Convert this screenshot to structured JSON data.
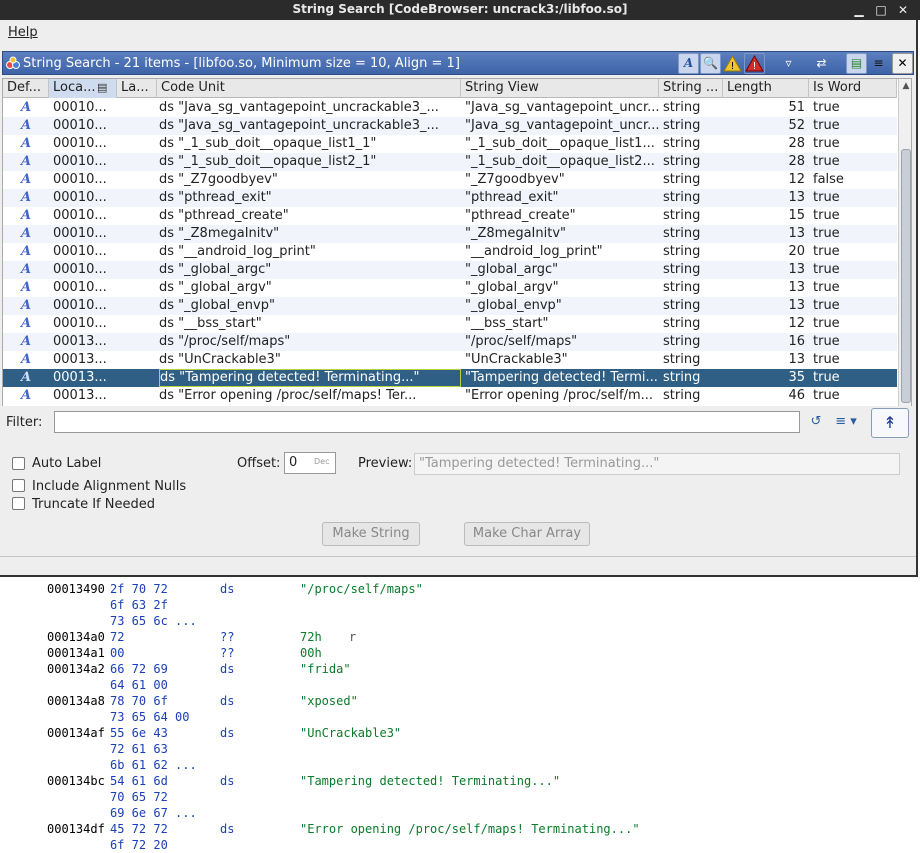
{
  "window": {
    "title": "String Search [CodeBrowser: uncrack3:/libfoo.so]",
    "minimize_glyph": "▁",
    "maximize_glyph": "□",
    "close_glyph": "✕"
  },
  "menu": {
    "help": "Help"
  },
  "panel": {
    "title": "String Search - 21 items - [libfoo.so, Minimum size = 10, Align = 1]",
    "toolbar_icons": [
      "string-type-icon",
      "search-icon",
      "warning-icon",
      "error-icon",
      "filter-icon",
      "refresh-icon",
      "make-selection-icon",
      "column-menu-icon",
      "close-panel-icon"
    ]
  },
  "table": {
    "columns": [
      "Def...",
      "Loca...",
      "La...",
      "Code Unit",
      "String View",
      "String ...",
      "Length",
      "Is Word"
    ],
    "selected_row_index": 15,
    "rows": [
      {
        "def": "A",
        "location": "00010...",
        "label": "",
        "code_unit": "ds \"Java_sg_vantagepoint_uncrackable3_...",
        "string_view": "\"Java_sg_vantagepoint_uncr...",
        "string_type": "string",
        "length": "51",
        "is_word": "true"
      },
      {
        "def": "A",
        "location": "00010...",
        "label": "",
        "code_unit": "ds \"Java_sg_vantagepoint_uncrackable3_...",
        "string_view": "\"Java_sg_vantagepoint_uncr...",
        "string_type": "string",
        "length": "52",
        "is_word": "true"
      },
      {
        "def": "A",
        "location": "00010...",
        "label": "",
        "code_unit": "ds \"_1_sub_doit__opaque_list1_1\"",
        "string_view": "\"_1_sub_doit__opaque_list1...",
        "string_type": "string",
        "length": "28",
        "is_word": "true"
      },
      {
        "def": "A",
        "location": "00010...",
        "label": "",
        "code_unit": "ds \"_1_sub_doit__opaque_list2_1\"",
        "string_view": "\"_1_sub_doit__opaque_list2...",
        "string_type": "string",
        "length": "28",
        "is_word": "true"
      },
      {
        "def": "A",
        "location": "00010...",
        "label": "",
        "code_unit": "ds \"_Z7goodbyev\"",
        "string_view": "\"_Z7goodbyev\"",
        "string_type": "string",
        "length": "12",
        "is_word": "false"
      },
      {
        "def": "A",
        "location": "00010...",
        "label": "",
        "code_unit": "ds \"pthread_exit\"",
        "string_view": "\"pthread_exit\"",
        "string_type": "string",
        "length": "13",
        "is_word": "true"
      },
      {
        "def": "A",
        "location": "00010...",
        "label": "",
        "code_unit": "ds \"pthread_create\"",
        "string_view": "\"pthread_create\"",
        "string_type": "string",
        "length": "15",
        "is_word": "true"
      },
      {
        "def": "A",
        "location": "00010...",
        "label": "",
        "code_unit": "ds \"_Z8megaInitv\"",
        "string_view": "\"_Z8megaInitv\"",
        "string_type": "string",
        "length": "13",
        "is_word": "true"
      },
      {
        "def": "A",
        "location": "00010...",
        "label": "",
        "code_unit": "ds \"__android_log_print\"",
        "string_view": "\"__android_log_print\"",
        "string_type": "string",
        "length": "20",
        "is_word": "true"
      },
      {
        "def": "A",
        "location": "00010...",
        "label": "",
        "code_unit": "ds \"_global_argc\"",
        "string_view": "\"_global_argc\"",
        "string_type": "string",
        "length": "13",
        "is_word": "true"
      },
      {
        "def": "A",
        "location": "00010...",
        "label": "",
        "code_unit": "ds \"_global_argv\"",
        "string_view": "\"_global_argv\"",
        "string_type": "string",
        "length": "13",
        "is_word": "true"
      },
      {
        "def": "A",
        "location": "00010...",
        "label": "",
        "code_unit": "ds \"_global_envp\"",
        "string_view": "\"_global_envp\"",
        "string_type": "string",
        "length": "13",
        "is_word": "true"
      },
      {
        "def": "A",
        "location": "00010...",
        "label": "",
        "code_unit": "ds \"__bss_start\"",
        "string_view": "\"__bss_start\"",
        "string_type": "string",
        "length": "12",
        "is_word": "true"
      },
      {
        "def": "A",
        "location": "00013...",
        "label": "",
        "code_unit": "ds \"/proc/self/maps\"",
        "string_view": "\"/proc/self/maps\"",
        "string_type": "string",
        "length": "16",
        "is_word": "true"
      },
      {
        "def": "A",
        "location": "00013...",
        "label": "",
        "code_unit": "ds \"UnCrackable3\"",
        "string_view": "\"UnCrackable3\"",
        "string_type": "string",
        "length": "13",
        "is_word": "true"
      },
      {
        "def": "A",
        "location": "00013...",
        "label": "",
        "code_unit": "ds \"Tampering detected! Terminating...\"",
        "string_view": "\"Tampering detected! Termi...",
        "string_type": "string",
        "length": "35",
        "is_word": "true"
      },
      {
        "def": "A",
        "location": "00013...",
        "label": "",
        "code_unit": "ds \"Error opening /proc/self/maps! Ter...",
        "string_view": "\"Error opening /proc/self/m...",
        "string_type": "string",
        "length": "46",
        "is_word": "true"
      }
    ]
  },
  "filter": {
    "label": "Filter:",
    "value": ""
  },
  "options": {
    "auto_label": "Auto Label",
    "include_alignment_nulls": "Include Alignment Nulls",
    "truncate_if_needed": "Truncate If Needed",
    "offset_label": "Offset:",
    "offset_value": "0",
    "offset_unit": "Dec",
    "preview_label": "Preview:",
    "preview_value": "\"Tampering detected! Terminating...\"",
    "make_string": "Make String",
    "make_char_array": "Make Char Array"
  },
  "listing": [
    {
      "addr": "00013490",
      "bytes": "2f 70 72",
      "mnem": "ds",
      "oper": "\"/proc/self/maps\"",
      "comment": ""
    },
    {
      "addr": "",
      "bytes": "6f 63 2f",
      "mnem": "",
      "oper": "",
      "comment": ""
    },
    {
      "addr": "",
      "bytes": "73 65 6c ...",
      "mnem": "",
      "oper": "",
      "comment": ""
    },
    {
      "addr": "000134a0",
      "bytes": "72",
      "mnem": "??",
      "oper": "72h",
      "comment": "r"
    },
    {
      "addr": "000134a1",
      "bytes": "00",
      "mnem": "??",
      "oper": "00h",
      "comment": ""
    },
    {
      "addr": "000134a2",
      "bytes": "66 72 69",
      "mnem": "ds",
      "oper": "\"frida\"",
      "comment": ""
    },
    {
      "addr": "",
      "bytes": "64 61 00",
      "mnem": "",
      "oper": "",
      "comment": ""
    },
    {
      "addr": "000134a8",
      "bytes": "78 70 6f",
      "mnem": "ds",
      "oper": "\"xposed\"",
      "comment": ""
    },
    {
      "addr": "",
      "bytes": "73 65 64 00",
      "mnem": "",
      "oper": "",
      "comment": ""
    },
    {
      "addr": "000134af",
      "bytes": "55 6e 43",
      "mnem": "ds",
      "oper": "\"UnCrackable3\"",
      "comment": ""
    },
    {
      "addr": "",
      "bytes": "72 61 63",
      "mnem": "",
      "oper": "",
      "comment": ""
    },
    {
      "addr": "",
      "bytes": "6b 61 62 ...",
      "mnem": "",
      "oper": "",
      "comment": ""
    },
    {
      "addr": "000134bc",
      "bytes": "54 61 6d",
      "mnem": "ds",
      "oper": "\"Tampering detected! Terminating...\"",
      "comment": ""
    },
    {
      "addr": "",
      "bytes": "70 65 72",
      "mnem": "",
      "oper": "",
      "comment": ""
    },
    {
      "addr": "",
      "bytes": "69 6e 67 ...",
      "mnem": "",
      "oper": "",
      "comment": ""
    },
    {
      "addr": "000134df",
      "bytes": "45 72 72",
      "mnem": "ds",
      "oper": "\"Error opening /proc/self/maps! Terminating...\"",
      "comment": ""
    },
    {
      "addr": "",
      "bytes": "6f 72 20",
      "mnem": "",
      "oper": "",
      "comment": ""
    }
  ]
}
